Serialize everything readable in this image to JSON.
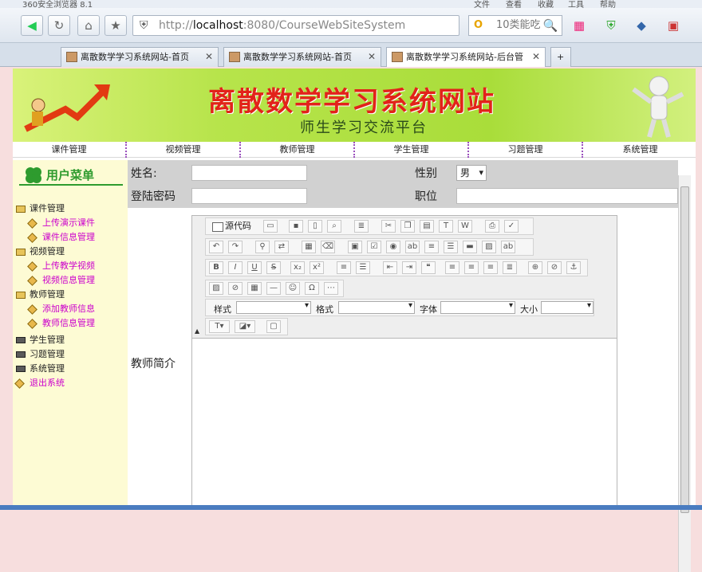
{
  "browser": {
    "window_title": "360安全浏览器 8.1",
    "menu": [
      "文件",
      "查看",
      "收藏",
      "工具",
      "帮助"
    ],
    "address_prefix": "http://",
    "address_host": "localhost",
    "address_rest": ":8080/CourseWebSiteSystem",
    "search_placeholder": "10类能吃",
    "tabs": [
      {
        "label": "离散数学学习系统网站-首页"
      },
      {
        "label": "离散数学学习系统网站-首页"
      },
      {
        "label": "离散数学学习系统网站-后台管"
      }
    ]
  },
  "site": {
    "title": "离散数学学习系统网站",
    "subtitle": "师生学习交流平台"
  },
  "nav": [
    "课件管理",
    "视频管理",
    "教师管理",
    "学生管理",
    "习题管理",
    "系统管理"
  ],
  "sidebar": {
    "heading": "用户菜单",
    "items": [
      {
        "label": "课件管理",
        "level": 0,
        "icon": "folder-icon"
      },
      {
        "label": "上传演示课件",
        "level": 1,
        "icon": "diamond-icon"
      },
      {
        "label": "课件信息管理",
        "level": 1,
        "icon": "diamond-icon"
      },
      {
        "label": "视频管理",
        "level": 0,
        "icon": "folder-icon"
      },
      {
        "label": "上传教学视频",
        "level": 1,
        "icon": "diamond-icon"
      },
      {
        "label": "视频信息管理",
        "level": 1,
        "icon": "diamond-icon"
      },
      {
        "label": "教师管理",
        "level": 0,
        "icon": "folder-icon"
      },
      {
        "label": "添加教师信息",
        "level": 1,
        "icon": "diamond-icon"
      },
      {
        "label": "教师信息管理",
        "level": 1,
        "icon": "diamond-icon"
      },
      {
        "label": "学生管理",
        "level": 0,
        "icon": "closed-folder-icon"
      },
      {
        "label": "习题管理",
        "level": 0,
        "icon": "closed-folder-icon"
      },
      {
        "label": "系统管理",
        "level": 0,
        "icon": "closed-folder-icon"
      },
      {
        "label": "退出系统",
        "level": 0,
        "icon": "diamond-icon"
      }
    ]
  },
  "form": {
    "name_label": "姓名:",
    "gender_label": "性别",
    "gender_value": "男",
    "password_label": "登陆密码",
    "position_label": "职位",
    "intro_label": "教师简介"
  },
  "editor": {
    "source_label": "源代码",
    "style_label": "样式",
    "format_label": "格式",
    "font_label": "字体",
    "size_label": "大小"
  }
}
